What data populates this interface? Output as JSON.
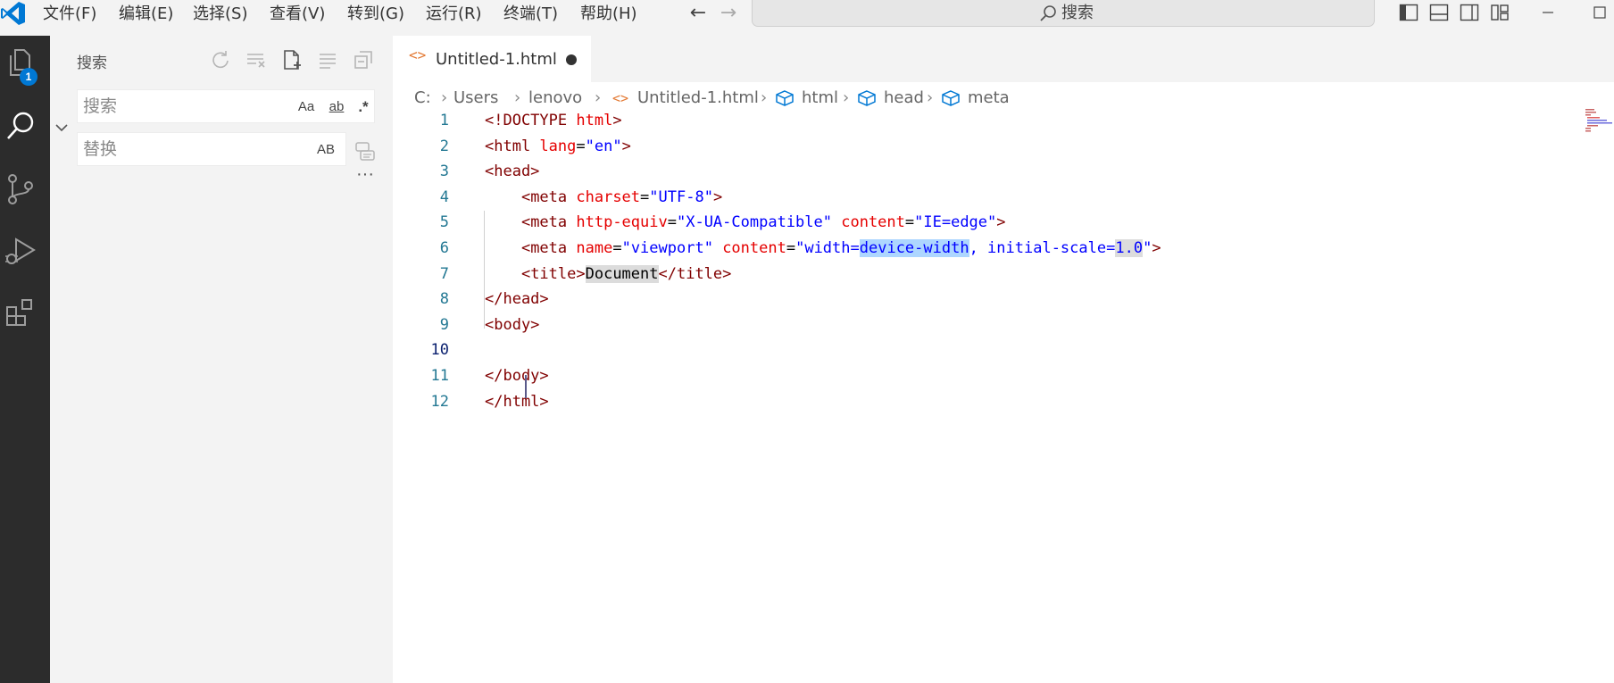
{
  "menu": {
    "items": [
      "文件(F)",
      "编辑(E)",
      "选择(S)",
      "查看(V)",
      "转到(G)",
      "运行(R)",
      "终端(T)",
      "帮助(H)"
    ]
  },
  "command_center": {
    "text": "搜索"
  },
  "activity_bar": {
    "explorer_badge": "1"
  },
  "sidebar": {
    "title": "搜索",
    "search_placeholder": "搜索",
    "replace_placeholder": "替换",
    "search_options": {
      "match_case": "Aa",
      "whole_word": "ab",
      "regex": ".*"
    },
    "replace_option": {
      "preserve_case": "AB"
    },
    "more": "···"
  },
  "editor": {
    "tab": {
      "label": "Untitled-1.html"
    },
    "breadcrumb": [
      "C:",
      "Users",
      "lenovo",
      "Untitled-1.html",
      "html",
      "head",
      "meta"
    ],
    "line_numbers": [
      "1",
      "2",
      "3",
      "4",
      "5",
      "6",
      "7",
      "8",
      "9",
      "10",
      "11",
      "12"
    ],
    "code": [
      "<!DOCTYPE html>",
      "<html lang=\"en\">",
      "<head>",
      "    <meta charset=\"UTF-8\">",
      "    <meta http-equiv=\"X-UA-Compatible\" content=\"IE=edge\">",
      "    <meta name=\"viewport\" content=\"width=device-width, initial-scale=1.0\">",
      "    <title>Document</title>",
      "</head>",
      "<body>",
      "    ",
      "</body>",
      "</html>"
    ]
  },
  "colors": {
    "accent": "#0078d4",
    "activity_bar_bg": "#2c2c2c",
    "tag": "#800000",
    "attribute": "#e50000",
    "attribute_value": "#0000ff",
    "line_number": "#237893",
    "selection": "#add6ff"
  }
}
